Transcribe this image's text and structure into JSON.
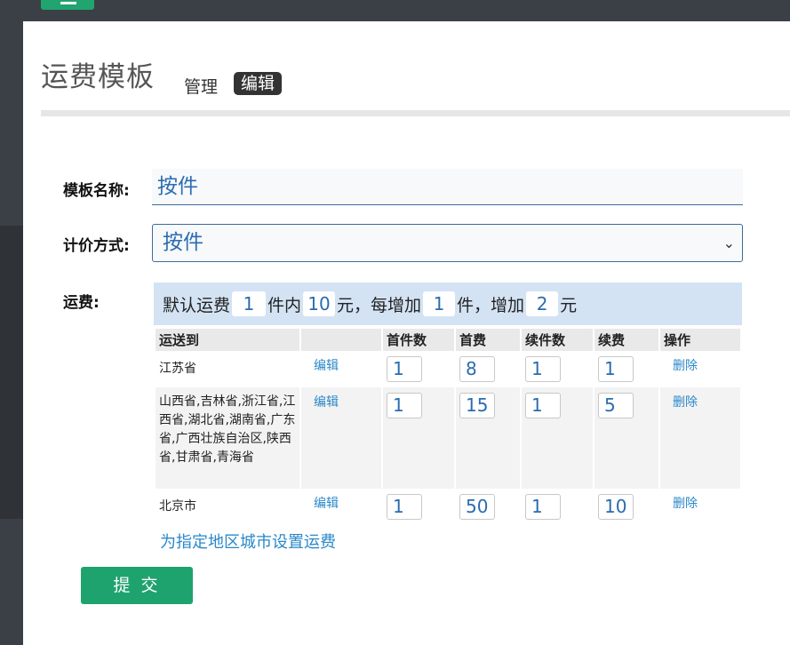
{
  "header": {
    "title": "运费模板",
    "crumb_manage": "管理",
    "crumb_edit": "编辑"
  },
  "form": {
    "name_label": "模板名称:",
    "name_value": "按件",
    "method_label": "计价方式:",
    "method_value": "按件",
    "fee_label": "运费:"
  },
  "default_fee": {
    "prefix": "默认运费",
    "first_count": "1",
    "within": "件内",
    "first_fee": "10",
    "yuan_each": "元，每增加",
    "add_count": "1",
    "piece_add": "件，增加",
    "add_fee": "2",
    "yuan": "元"
  },
  "table": {
    "headers": [
      "运送到",
      "",
      "首件数",
      "首费",
      "续件数",
      "续费",
      "操作"
    ],
    "rows": [
      {
        "region": "江苏省",
        "edit": "编辑",
        "first": "1",
        "first_fee": "8",
        "add": "1",
        "add_fee": "1",
        "delete": "删除"
      },
      {
        "region": "山西省,吉林省,浙江省,江西省,湖北省,湖南省,广东省,广西壮族自治区,陕西省,甘肃省,青海省",
        "edit": "编辑",
        "first": "1",
        "first_fee": "15",
        "add": "1",
        "add_fee": "5",
        "delete": "删除"
      },
      {
        "region": "北京市",
        "edit": "编辑",
        "first": "1",
        "first_fee": "50",
        "add": "1",
        "add_fee": "10",
        "delete": "删除"
      }
    ]
  },
  "add_region_link": "为指定地区城市设置运费",
  "submit_label": "提 交",
  "colors": {
    "accent": "#1fa36e",
    "link": "#2a88c9",
    "input_text": "#2a6cb0"
  }
}
